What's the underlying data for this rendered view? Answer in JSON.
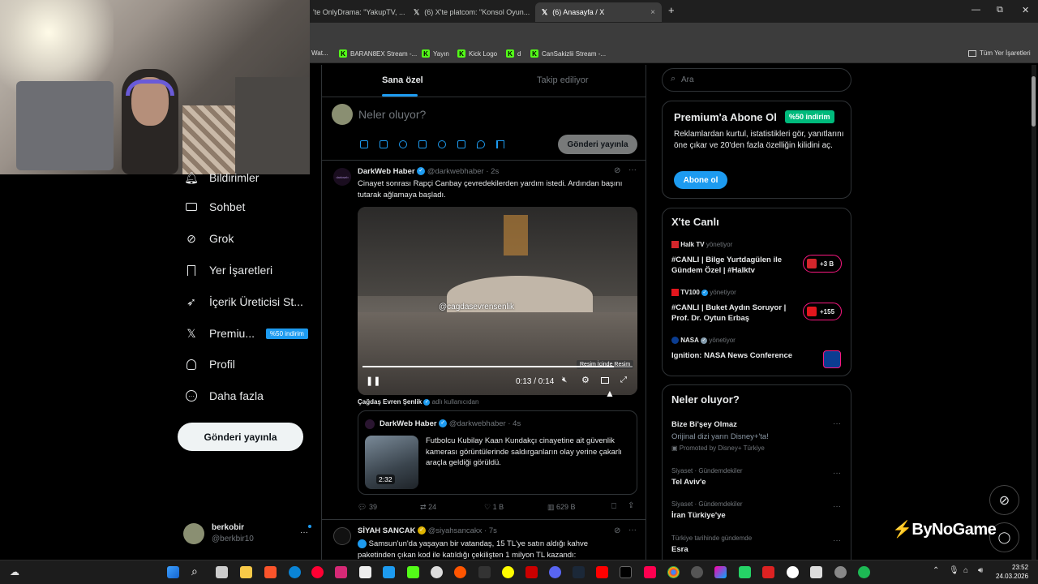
{
  "browser": {
    "tabs": [
      {
        "label": "'te OnlyDrama: \"YakupTV, ...",
        "close": "×"
      },
      {
        "label": "(6) X'te platcom: \"Konsol Oyun...",
        "close": "×"
      },
      {
        "label": "(6) Anasayfa / X",
        "close": "×"
      }
    ],
    "new_tab": "+",
    "window_controls": [
      "—",
      "⧉",
      "✕"
    ],
    "bookmarks": [
      {
        "label": "Wat...",
        "icon": "generic"
      },
      {
        "label": "BARAN8EX Stream -...",
        "icon": "kick"
      },
      {
        "label": "Yayın",
        "icon": "kick"
      },
      {
        "label": "Kick Logo",
        "icon": "kick"
      },
      {
        "label": "d",
        "icon": "kick"
      },
      {
        "label": "CanSakizlii Stream -...",
        "icon": "kick"
      }
    ],
    "all_bookmarks": "Tüm Yer İşaretleri"
  },
  "nav": {
    "items": [
      {
        "label": "Bildirimler",
        "icon": "bell-icon"
      },
      {
        "label": "Sohbet",
        "icon": "mail-icon"
      },
      {
        "label": "Grok",
        "icon": "grok-icon"
      },
      {
        "label": "Yer İşaretleri",
        "icon": "bookmark-icon"
      },
      {
        "label": "İçerik Üreticisi St...",
        "icon": "rocket-icon"
      },
      {
        "label": "Premiu...",
        "icon": "x-logo-icon"
      },
      {
        "label": "Profil",
        "icon": "person-icon"
      },
      {
        "label": "Daha fazla",
        "icon": "more-icon"
      }
    ],
    "premium_badge": "%50 indirim",
    "post_button": "Gönderi yayınla",
    "user": {
      "name": "berkobir",
      "handle": "@berkbir10",
      "more": "···"
    }
  },
  "timeline": {
    "tabs": [
      "Sana özel",
      "Takip ediliyor"
    ],
    "composer": {
      "placeholder": "Neler oluyor?",
      "post_button": "Gönderi yayınla"
    },
    "tweet1": {
      "name": "DarkWeb Haber",
      "handle": "@darkwebhaber",
      "time": "· 2s",
      "avatar_text": "darkweb",
      "text": "Cinayet sonrası Rapçi Canbay çevredekilerden yardım istedi. Ardından başını tutarak ağlamaya başladı.",
      "video": {
        "watermark": "@cagdasevrensenlik",
        "time": "0:13 / 0:14",
        "tooltip": "Resim İçinde Resim",
        "progress": 0.93
      },
      "attribution": {
        "name": "Çağdaş Evren Şenlik",
        "suffix": "adlı kullanıcıdan"
      },
      "quote": {
        "name": "DarkWeb Haber",
        "handle": "@darkwebhaber",
        "time": "· 4s",
        "text": "Futbolcu Kubilay Kaan Kundakçı cinayetine ait güvenlik kamerası görüntülerinde saldırganların olay yerine çakarlı araçla geldiği görüldü.",
        "duration": "2:32"
      },
      "actions": {
        "replies": "39",
        "reposts": "24",
        "likes": "1 B",
        "views": "629 B"
      }
    },
    "tweet2": {
      "name": "SİYAH SANCAK",
      "handle": "@siyahsancakx",
      "time": "· 7s",
      "text_line1": "Samsun'un'da yaşayan bir vatandaş, 15 TL'ye satın aldığı kahve",
      "text_line2": "paketinden çıkan kod ile katıldığı çekilişten 1 milyon TL kazandı:"
    }
  },
  "right": {
    "search_placeholder": "Ara",
    "premium": {
      "title": "Premium'a Abone Ol",
      "badge": "%50 indirim",
      "text": "Reklamlardan kurtul, istatistikleri gör, yanıtlarını öne çıkar ve 20'den fazla özelliğin kilidini aç.",
      "button": "Abone ol"
    },
    "live": {
      "title": "X'te Canlı",
      "items": [
        {
          "host": "Halk TV",
          "role": "yönetiyor",
          "title": "#CANLI | Bilge Yurtdagülen ile Gündem Özel | #Halktv",
          "count": "+3 B"
        },
        {
          "host": "TV100",
          "role": "yönetiyor",
          "title": "#CANLI | Buket Aydın Soruyor | Prof. Dr. Oytun Erbaş",
          "count": "+155"
        },
        {
          "host": "NASA",
          "role": "yönetiyor",
          "title": "Ignition: NASA News Conference",
          "count": ""
        }
      ]
    },
    "trends": {
      "title": "Neler oluyor?",
      "items": [
        {
          "category": "",
          "name": "Bize Bi'şey Olmaz",
          "sub": "Orijinal dizi yarın Disney+'ta!",
          "promo": "Promoted by Disney+ Türkiye"
        },
        {
          "category": "Siyaset · Gündemdekiler",
          "name": "Tel Aviv'e",
          "sub": "",
          "promo": ""
        },
        {
          "category": "Siyaset · Gündemdekiler",
          "name": "İran Türkiye'ye",
          "sub": "",
          "promo": ""
        },
        {
          "category": "Türkiye tarihinde gündemde",
          "name": "Esra",
          "sub": "",
          "promo": ""
        }
      ]
    }
  },
  "overlay": {
    "brand": "ByNoGame"
  },
  "taskbar": {
    "time": "23:52",
    "date": "24.03.2026"
  },
  "colors": {
    "accent": "#1d9bf0",
    "kick": "#53fc18",
    "premium_badge": "#00ba7c"
  }
}
